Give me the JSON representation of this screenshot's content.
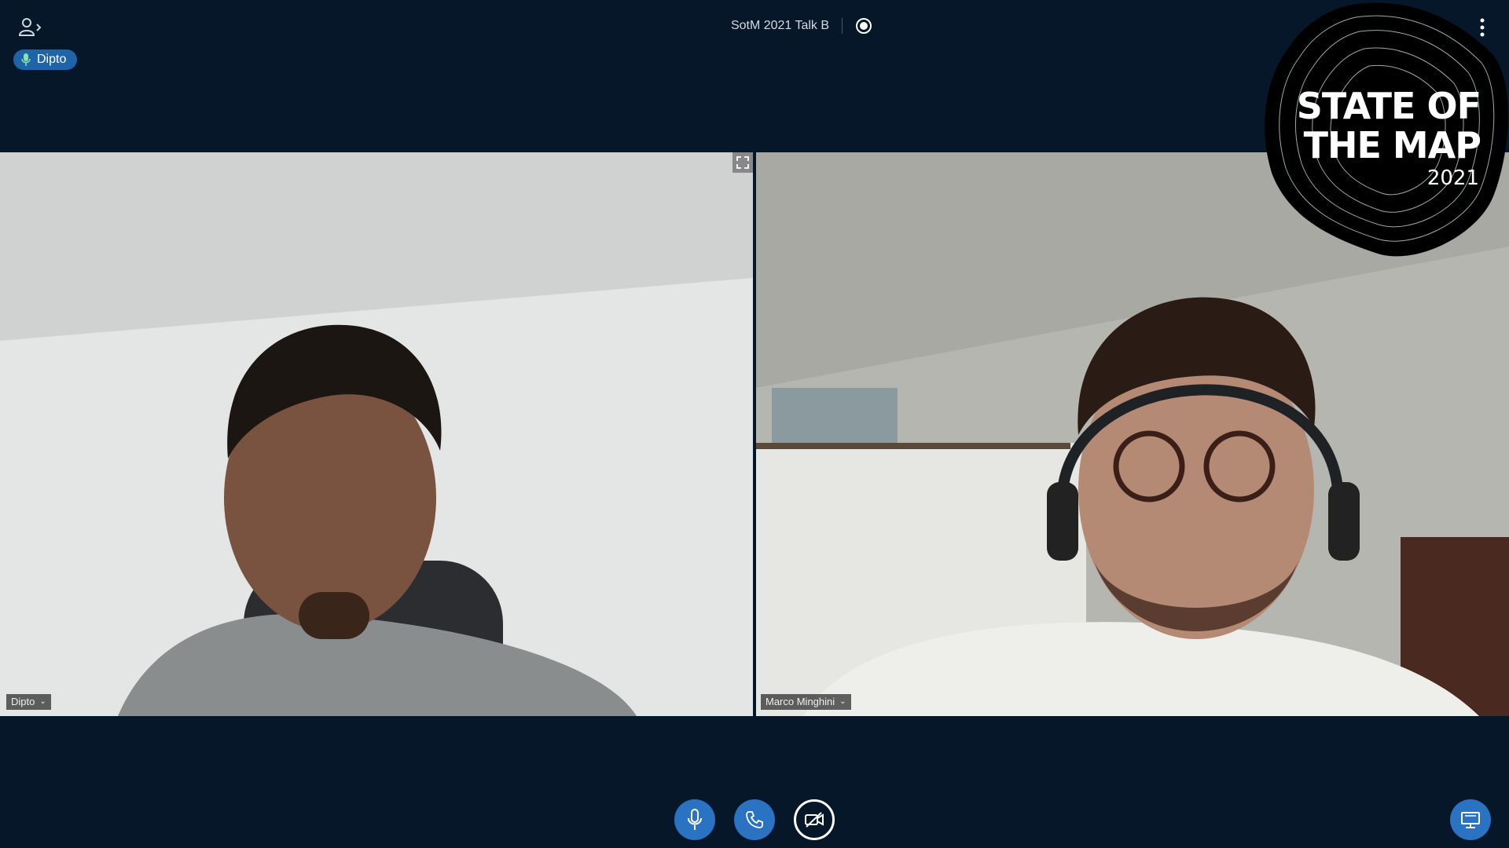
{
  "header": {
    "meeting_title": "SotM 2021 Talk B",
    "talker_name": "Dipto"
  },
  "logo": {
    "line1": "STATE OF",
    "line2": "THE MAP",
    "year": "2021"
  },
  "videos": [
    {
      "name": "Dipto",
      "active": true
    },
    {
      "name": "Marco Minghini",
      "active": false
    }
  ],
  "icons": {
    "user_list": "user-list-icon",
    "talker_mic": "microphone-icon",
    "recording": "record-icon",
    "options": "more-vertical-icon",
    "fullscreen": "fullscreen-icon",
    "mute": "microphone-icon",
    "audio": "phone-icon",
    "video": "video-off-icon",
    "presentation": "presentation-icon"
  },
  "colors": {
    "background": "#06172a",
    "primary": "#2a73c2",
    "active_border": "#2f69b3"
  }
}
